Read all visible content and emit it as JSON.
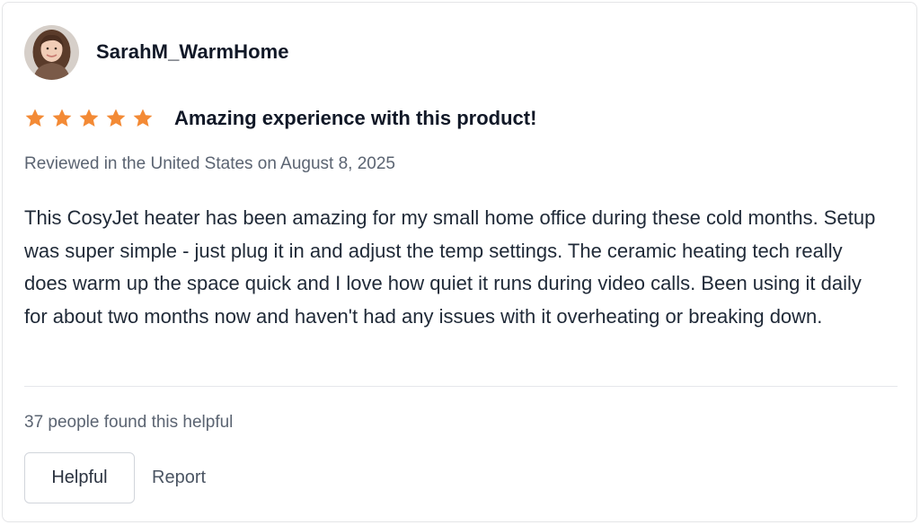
{
  "review": {
    "reviewer": {
      "name": "SarahM_WarmHome",
      "avatar_icon": "user-avatar-photo"
    },
    "rating": {
      "value": 5,
      "max": 5,
      "star_color": "#f38a35",
      "star_icon": "star-icon"
    },
    "title": "Amazing experience with this product!",
    "meta": "Reviewed in the United States on August 8, 2025",
    "body": "This CosyJet heater has been amazing for my small home office during these cold months. Setup was super simple - just plug it in and adjust the temp settings. The ceramic heating tech really does warm up the space quick and I love how quiet it runs during video calls. Been using it daily for about two months now and haven't had any issues with it overheating or breaking down.",
    "helpful_count_text": "37 people found this helpful",
    "actions": {
      "helpful_label": "Helpful",
      "report_label": "Report"
    }
  }
}
